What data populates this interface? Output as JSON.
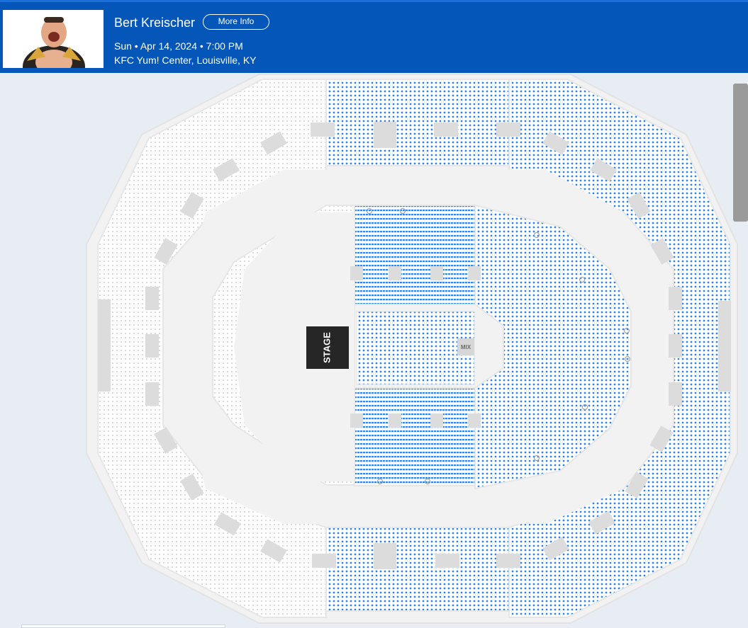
{
  "event": {
    "title": "Bert Kreischer",
    "more_info_label": "More Info",
    "date_time": "Sun • Apr 14, 2024 • 7:00 PM",
    "venue": "KFC Yum! Center, Louisville, KY"
  },
  "map": {
    "stage_label": "STAGE",
    "mix_label": "MIX"
  },
  "colors": {
    "header": "#0457b8",
    "available_seat": "#2f86e6",
    "unavailable_seat": "#d2d2d2",
    "stage": "#262626"
  },
  "icons": [
    "event-thumbnail",
    "accessibility-icon"
  ]
}
